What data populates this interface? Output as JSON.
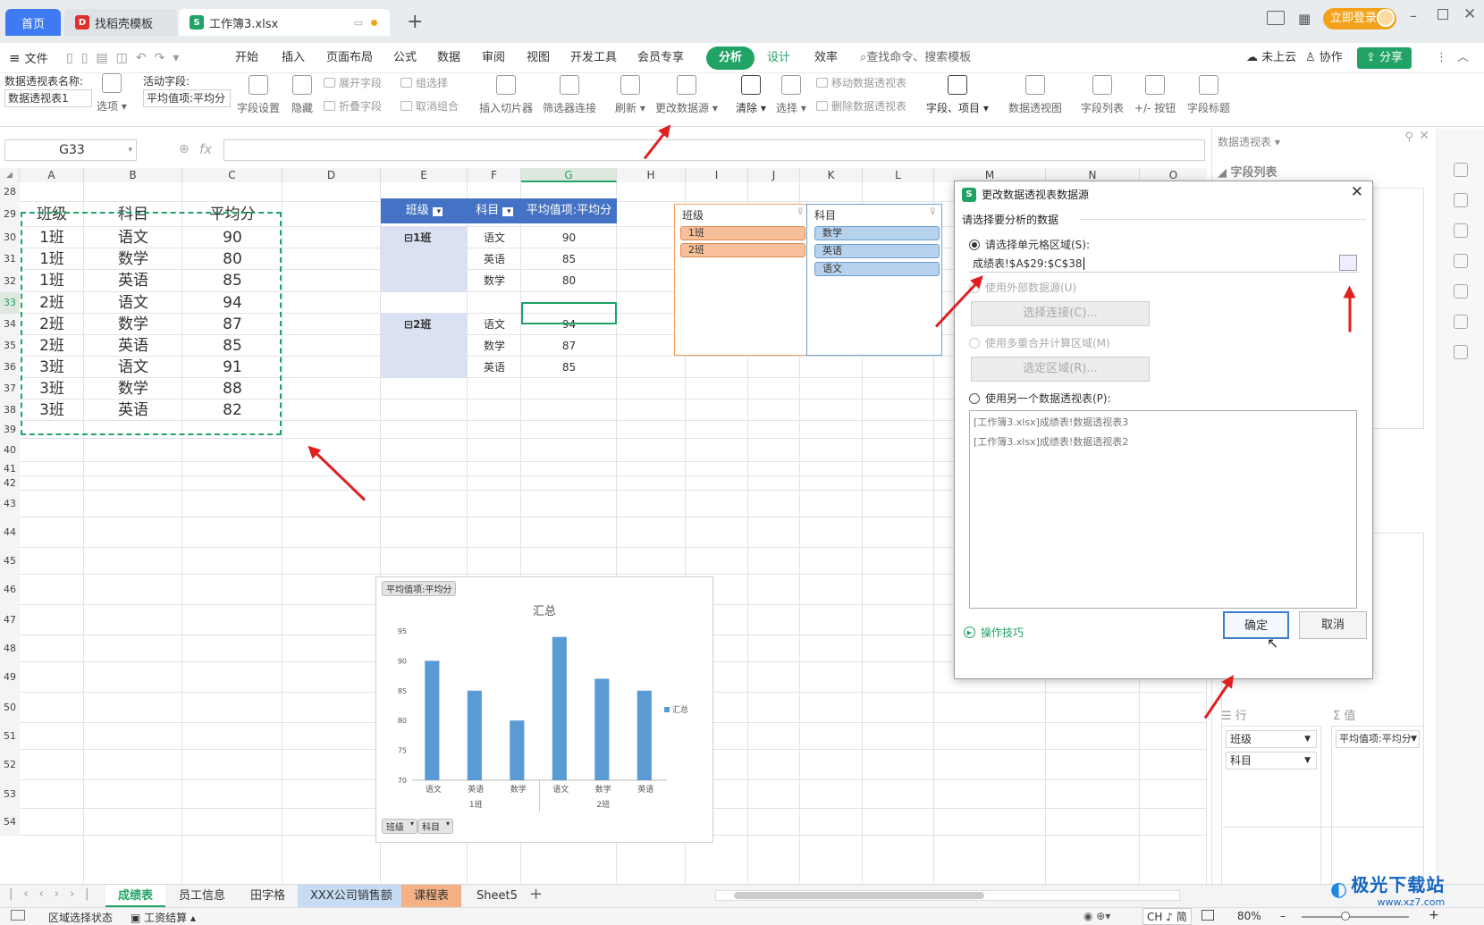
{
  "tabs": {
    "home": "首页",
    "template": "找稻壳模板",
    "file": "工作簿3.xlsx"
  },
  "title_right": {
    "login": "立即登录"
  },
  "menu": {
    "file": "文件",
    "items": [
      "开始",
      "插入",
      "页面布局",
      "公式",
      "数据",
      "审阅",
      "视图",
      "开发工具",
      "会员专享",
      "分析",
      "设计",
      "效率"
    ],
    "search": "查找命令、搜索模板",
    "cloud": "未上云",
    "collab": "协作",
    "share": "分享"
  },
  "ribbon": {
    "pivot_name_label": "数据透视表名称:",
    "pivot_name_value": "数据透视表1",
    "options": "选项",
    "active_field_label": "活动字段:",
    "active_field_value": "平均值项:平均分",
    "field_settings": "字段设置",
    "hide": "隐藏",
    "expand_field": "展开字段",
    "collapse_field": "折叠字段",
    "group_selection": "组选择",
    "ungroup": "取消组合",
    "insert_slicer": "插入切片器",
    "filter_connection": "筛选器连接",
    "refresh": "刷新",
    "change_source": "更改数据源",
    "clear": "清除",
    "select": "选择",
    "move_pivot": "移动数据透视表",
    "delete_pivot": "删除数据透视表",
    "fields_items": "字段、项目",
    "pivot_chart": "数据透视图",
    "field_list": "字段列表",
    "plus_minus": "+/- 按钮",
    "field_headers": "字段标题"
  },
  "formula_bar": {
    "name_box": "G33",
    "fx": "fx",
    "value": ""
  },
  "columns": [
    "A",
    "B",
    "C",
    "D",
    "E",
    "F",
    "G",
    "H",
    "I",
    "J",
    "K",
    "L",
    "M",
    "N",
    "O"
  ],
  "rows": [
    "28",
    "29",
    "30",
    "31",
    "32",
    "33",
    "34",
    "35",
    "36",
    "37",
    "38",
    "39",
    "40",
    "41",
    "42",
    "43",
    "44",
    "45",
    "46",
    "47",
    "48",
    "49",
    "50",
    "51",
    "52",
    "53",
    "54"
  ],
  "source_table": {
    "headers": [
      "班级",
      "科目",
      "平均分"
    ],
    "rows": [
      [
        "1班",
        "语文",
        "90"
      ],
      [
        "1班",
        "数学",
        "80"
      ],
      [
        "1班",
        "英语",
        "85"
      ],
      [
        "2班",
        "语文",
        "94"
      ],
      [
        "2班",
        "数学",
        "87"
      ],
      [
        "2班",
        "英语",
        "85"
      ],
      [
        "3班",
        "语文",
        "91"
      ],
      [
        "3班",
        "数学",
        "88"
      ],
      [
        "3班",
        "英语",
        "82"
      ]
    ]
  },
  "pivot": {
    "headers": [
      "班级",
      "科目",
      "平均值项:平均分"
    ],
    "groups": [
      {
        "class": "1班",
        "rows": [
          [
            "语文",
            "90"
          ],
          [
            "英语",
            "85"
          ],
          [
            "数学",
            "80"
          ]
        ]
      },
      {
        "class": "2班",
        "rows": [
          [
            "语文",
            "94"
          ],
          [
            "数学",
            "87"
          ],
          [
            "英语",
            "85"
          ]
        ]
      }
    ]
  },
  "slicers": {
    "class": {
      "title": "班级",
      "items": [
        "1班",
        "2班"
      ]
    },
    "subject": {
      "title": "科目",
      "items": [
        "数学",
        "英语",
        "语文"
      ]
    }
  },
  "chart_tags": {
    "value_btn": "平均值项:平均分",
    "class_btn": "班级",
    "subject_btn": "科目"
  },
  "chart_data": {
    "type": "bar",
    "title": "汇总",
    "categories": [
      "语文",
      "英语",
      "数学",
      "语文",
      "数学",
      "英语"
    ],
    "groups": [
      "1班",
      "2班"
    ],
    "series": [
      {
        "name": "汇总",
        "values": [
          90,
          85,
          80,
          94,
          87,
          85
        ]
      }
    ],
    "ylim": [
      70,
      95
    ],
    "yticks": [
      "95",
      "90",
      "85",
      "80",
      "75",
      "70"
    ],
    "color": "#5b9bd5",
    "legend": "right"
  },
  "dialog": {
    "title": "更改数据透视表数据源",
    "section": "请选择要分析的数据",
    "opt_range": "请选择单元格区域(S):",
    "range_value": "成绩表!$A$29:$C$38",
    "opt_external": "使用外部数据源(U)",
    "btn_connection": "选择连接(C)...",
    "opt_multi": "使用多重合并计算区域(M)",
    "btn_select_range": "选定区域(R)...",
    "opt_other": "使用另一个数据透视表(P):",
    "list": [
      "[工作簿3.xlsx]成绩表!数据透视表3",
      "[工作簿3.xlsx]成绩表!数据透视表2"
    ],
    "tips": "操作技巧",
    "ok": "确定",
    "cancel": "取消"
  },
  "panel": {
    "title": "数据透视表",
    "field_list": "字段列表",
    "rows_label": "行",
    "values_label": "值",
    "rows_items": [
      "班级",
      "科目"
    ],
    "values_items": [
      "平均值项:平均分"
    ]
  },
  "sheets": [
    "成绩表",
    "员工信息",
    "田字格",
    "XXX公司销售额",
    "课程表",
    "Sheet5"
  ],
  "status": {
    "select_state": "区域选择状态",
    "payroll": "工资结算",
    "ime": "CH ♪ 简",
    "zoom": "80%"
  },
  "watermark": {
    "brand": "极光下载站",
    "url": "www.xz7.com"
  },
  "colors": {
    "accent_green": "#21a366",
    "blue_tab": "#3e7bf2",
    "pivot_header": "#4472c4",
    "chart_bar": "#5b9bd5",
    "arrow_red": "#e02020",
    "login_orange": "#f2a31b"
  }
}
